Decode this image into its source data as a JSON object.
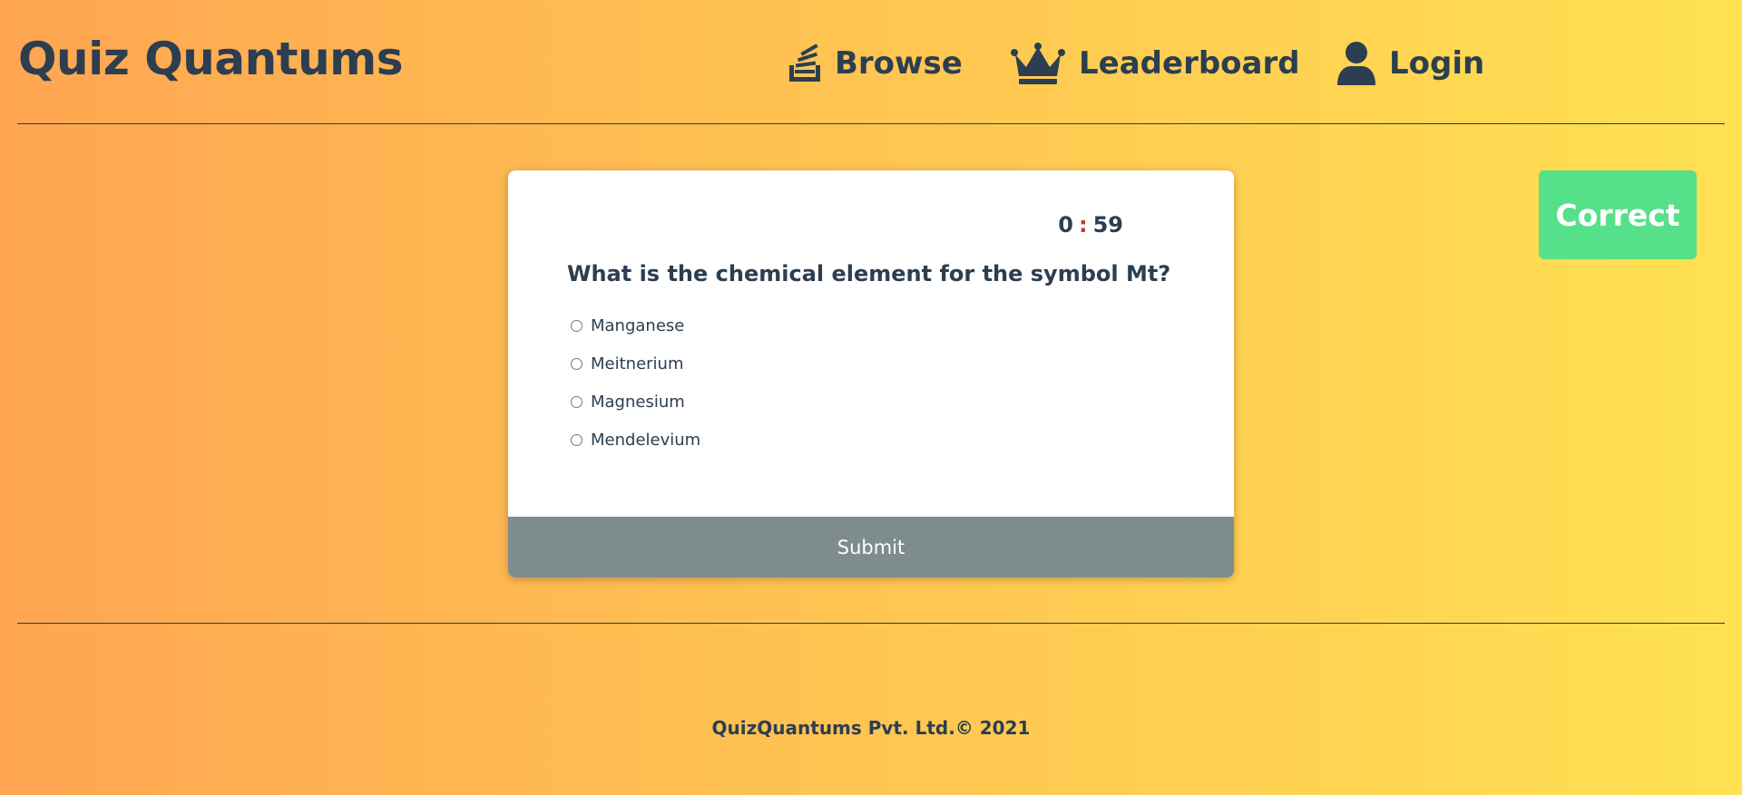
{
  "header": {
    "brand": "Quiz Quantums",
    "nav": [
      {
        "label": "Browse",
        "icon": "stack-icon"
      },
      {
        "label": "Leaderboard",
        "icon": "crown-icon"
      },
      {
        "label": "Login",
        "icon": "user-icon"
      }
    ]
  },
  "quiz": {
    "timer": {
      "minutes": "0",
      "separator": ":",
      "seconds": "59"
    },
    "question": "What is the chemical element for the symbol Mt?",
    "options": [
      "Manganese",
      "Meitnerium",
      "Magnesium",
      "Mendelevium"
    ],
    "submit_label": "Submit"
  },
  "result": {
    "label": "Correct",
    "color": "#57e08a"
  },
  "footer": {
    "text": "QuizQuantums Pvt. Ltd.© 2021"
  },
  "colors": {
    "text": "#2c3e50",
    "gradient_start": "#ffa552",
    "gradient_end": "#ffe152",
    "submit_bg": "#7f8c8d",
    "timer_separator": "#c0392b"
  }
}
